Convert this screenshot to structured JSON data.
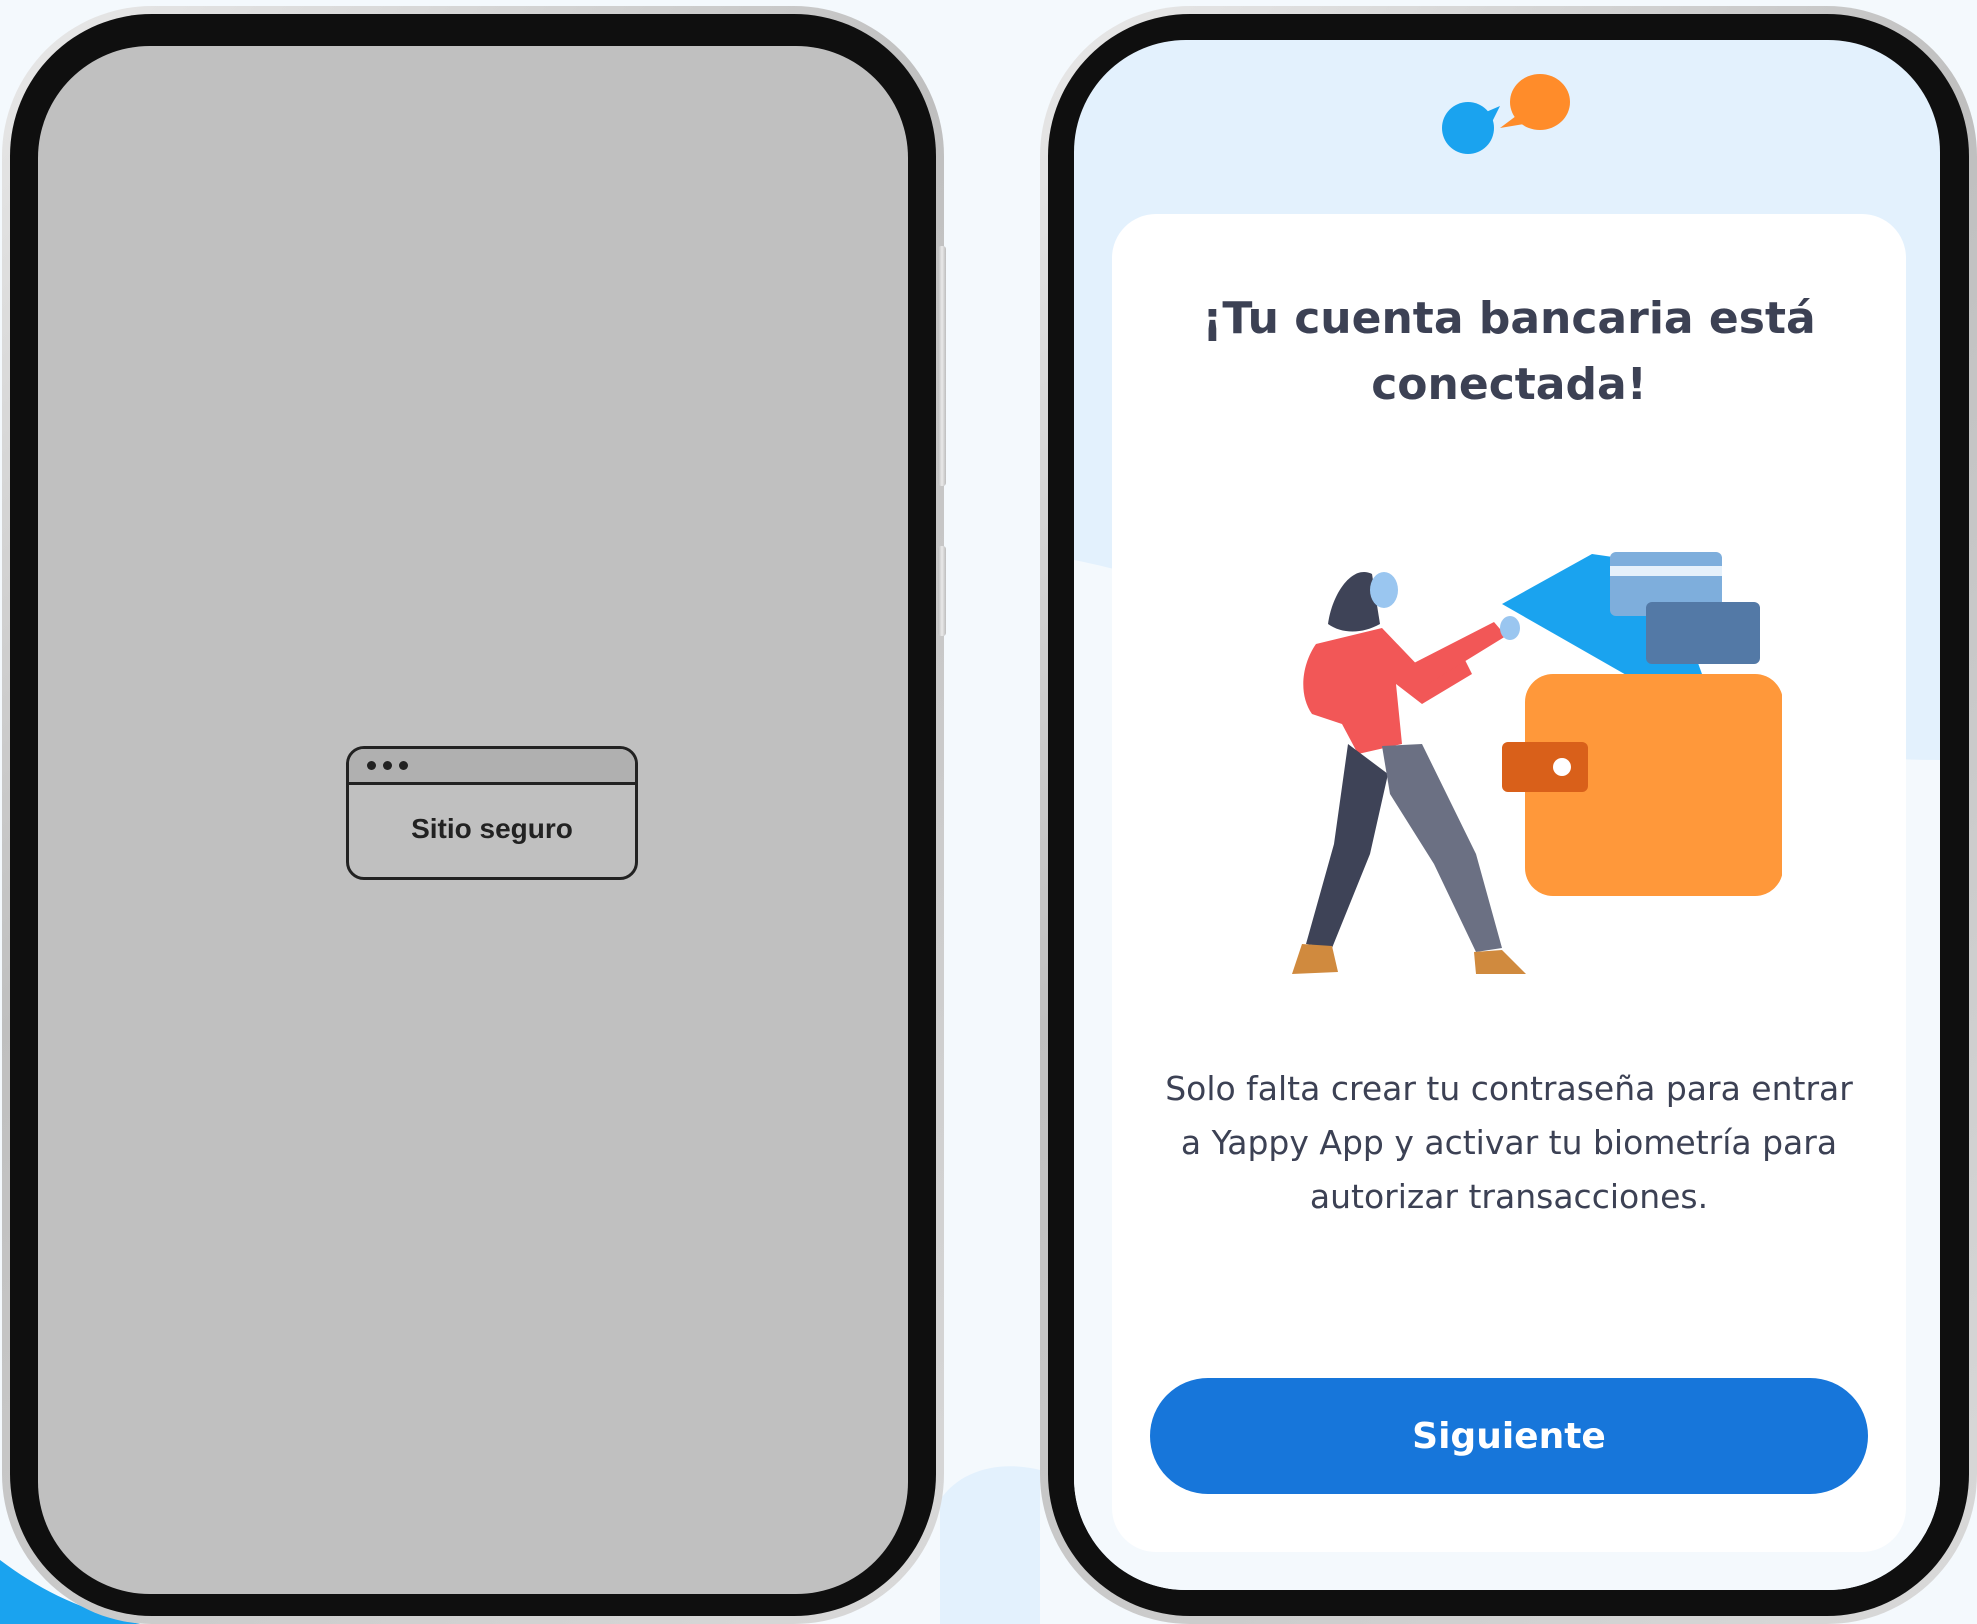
{
  "left_screen": {
    "secure_site_label": "Sitio seguro"
  },
  "right_screen": {
    "title": "¡Tu cuenta bancaria está conectada!",
    "message": "Solo falta crear tu contraseña para entrar a Yappy App y activar tu biometría para autorizar transacciones.",
    "next_button_label": "Siguiente"
  },
  "colors": {
    "primary_button": "#1776da",
    "logo_blue": "#1aa3ef",
    "logo_orange": "#ff8c2a",
    "heading_text": "#3c4154",
    "screen_background": "#e3f1fd",
    "webview_placeholder": "#c0c0c0"
  },
  "icons": {
    "brand": "yappy-chat-bubbles-logo",
    "illustration": "woman-pulling-card-from-wallet"
  }
}
